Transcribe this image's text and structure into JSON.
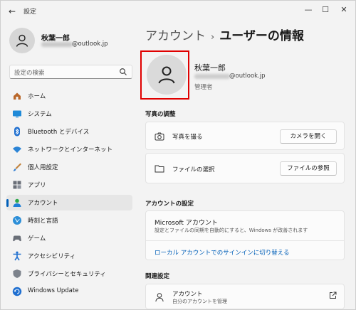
{
  "window": {
    "title": "設定",
    "back_icon": "back-arrow-icon",
    "minimize_icon": "minimize-icon",
    "maximize_icon": "maximize-icon",
    "close_icon": "close-icon"
  },
  "profile": {
    "name": "秋葉一郎",
    "email_suffix": "@outlook.jp"
  },
  "search": {
    "placeholder": "設定の検索"
  },
  "nav": {
    "items": [
      {
        "label": "ホーム",
        "icon": "home-icon",
        "selected": false
      },
      {
        "label": "システム",
        "icon": "system-display-icon",
        "selected": false
      },
      {
        "label": "Bluetooth とデバイス",
        "icon": "bluetooth-icon",
        "selected": false
      },
      {
        "label": "ネットワークとインターネット",
        "icon": "wifi-icon",
        "selected": false
      },
      {
        "label": "個人用設定",
        "icon": "paint-brush-icon",
        "selected": false
      },
      {
        "label": "アプリ",
        "icon": "apps-icon",
        "selected": false
      },
      {
        "label": "アカウント",
        "icon": "account-icon",
        "selected": true
      },
      {
        "label": "時刻と言語",
        "icon": "time-language-icon",
        "selected": false
      },
      {
        "label": "ゲーム",
        "icon": "gamepad-icon",
        "selected": false
      },
      {
        "label": "アクセシビリティ",
        "icon": "accessibility-icon",
        "selected": false
      },
      {
        "label": "プライバシーとセキュリティ",
        "icon": "shield-icon",
        "selected": false
      },
      {
        "label": "Windows Update",
        "icon": "windows-update-icon",
        "selected": false
      }
    ]
  },
  "breadcrumb": {
    "parent": "アカウント",
    "separator": "›",
    "current": "ユーザーの情報"
  },
  "user": {
    "name": "秋葉一郎",
    "email_suffix": "@outlook.jp",
    "role": "管理者"
  },
  "photo_section": {
    "title": "写真の調整",
    "rows": [
      {
        "label": "写真を撮る",
        "icon": "camera-icon",
        "button": "カメラを開く"
      },
      {
        "label": "ファイルの選択",
        "icon": "folder-icon",
        "button": "ファイルの参照"
      }
    ]
  },
  "account_section": {
    "title": "アカウントの設定",
    "card_title": "Microsoft アカウント",
    "card_desc": "設定とファイルの同期を自動的にすると、Windows が改善されます",
    "link": "ローカル アカウントでのサインインに切り替える"
  },
  "related_section": {
    "title": "関連設定",
    "item_title": "アカウント",
    "item_desc": "自分のアカウントを管理"
  },
  "colors": {
    "accent": "#005fb8",
    "highlight_box": "#e00000"
  }
}
